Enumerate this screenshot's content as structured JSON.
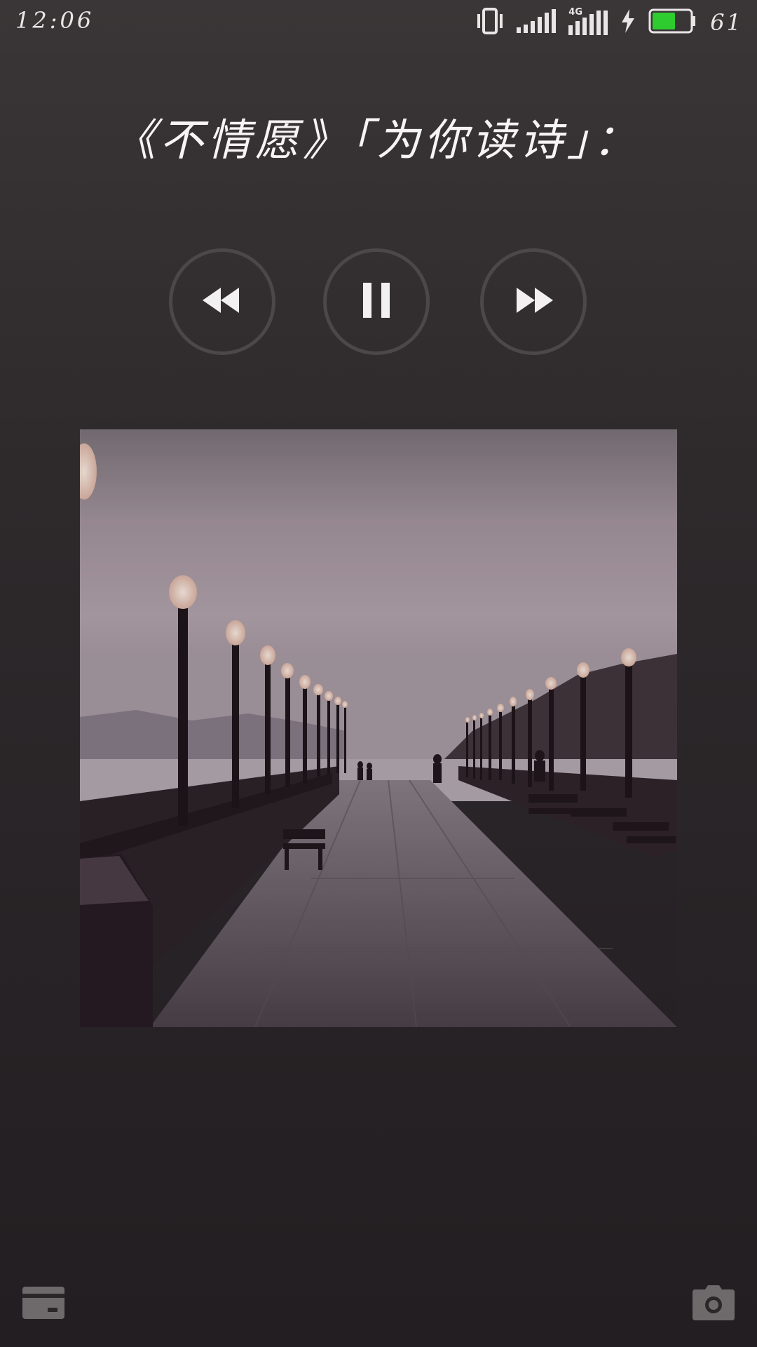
{
  "status_bar": {
    "time": "12:06",
    "battery_percent": "61",
    "network_label": "4G",
    "icons": [
      "vibrate-icon",
      "signal-icon",
      "signal-4g-icon",
      "charging-icon",
      "battery-icon"
    ],
    "battery_level": 0.61,
    "battery_color": "#2ecc2e"
  },
  "player": {
    "title": "《不情愿》「为你读诗」：",
    "controls": {
      "previous_icon": "rewind-icon",
      "play_pause_icon": "pause-icon",
      "next_icon": "fast-forward-icon"
    },
    "album_art": "pier-with-lamp-posts-at-dusk"
  },
  "bottom_bar": {
    "left_icon": "wallet-card-icon",
    "right_icon": "camera-icon"
  },
  "colors": {
    "background_top": "#3a3637",
    "background_bottom": "#221e21",
    "button_ring": "#4c4849",
    "icon_gray": "#6e6a6b"
  }
}
